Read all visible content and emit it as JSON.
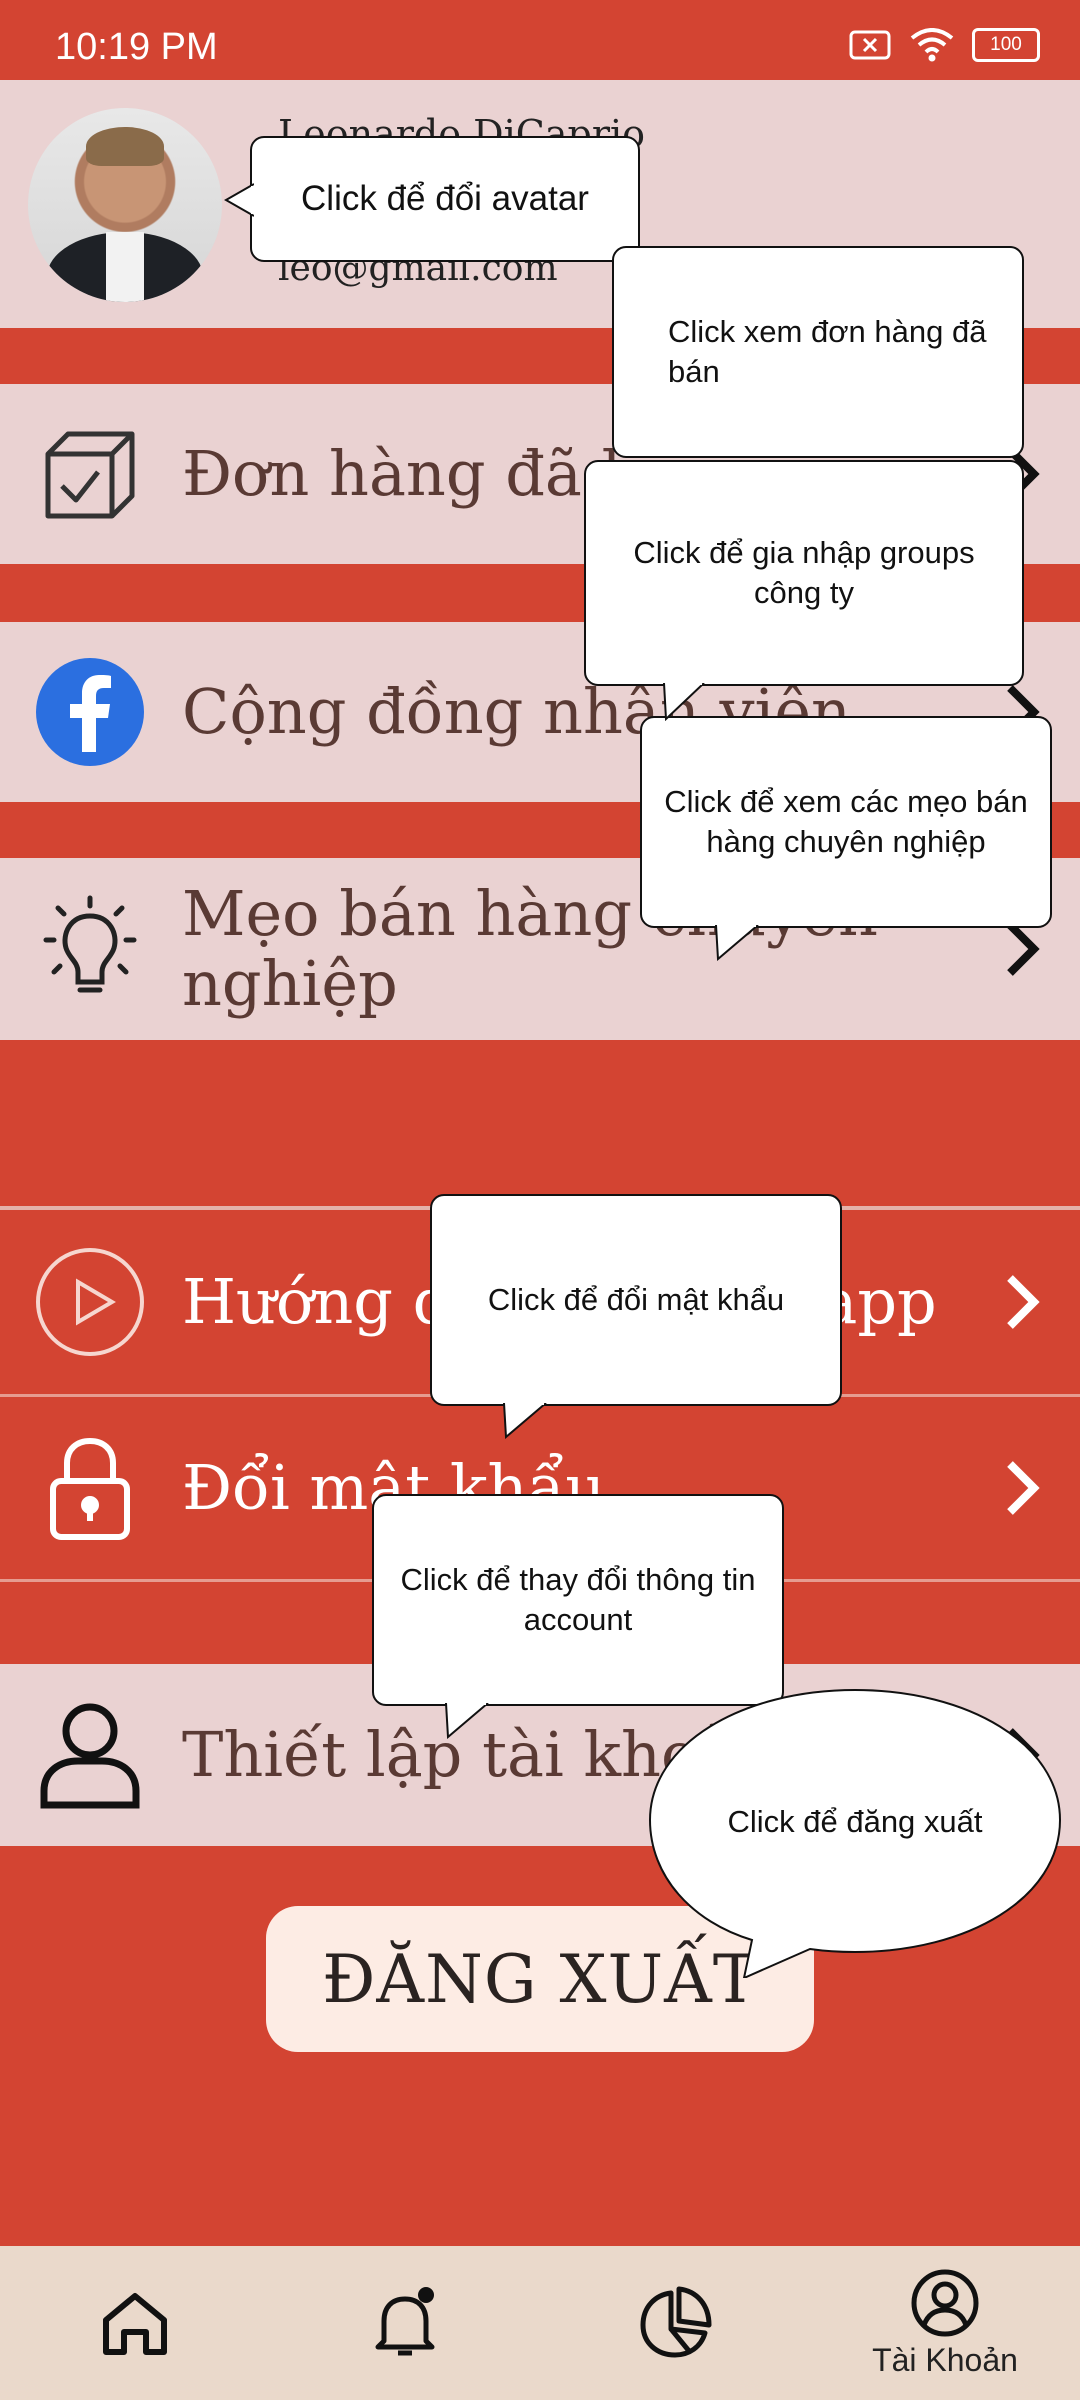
{
  "status_bar": {
    "time": "10:19 PM",
    "battery": "100"
  },
  "profile": {
    "name": "Leonardo DiCaprio",
    "email": "leo@gmail.com"
  },
  "menu": [
    {
      "label": "Đơn hàng đã bán",
      "icon": "box-check-icon"
    },
    {
      "label": "Cộng đồng nhân viên",
      "icon": "facebook-icon"
    },
    {
      "label": "Mẹo bán hàng chuyên nghiệp",
      "icon": "lightbulb-icon"
    },
    {
      "label": "Hướng dẫn sử dụng app",
      "icon": "play-icon"
    },
    {
      "label": "Đổi mật khẩu",
      "icon": "lock-icon"
    },
    {
      "label": "Thiết lập tài khoản",
      "icon": "user-icon"
    }
  ],
  "logout_label": "ĐĂNG XUẤT",
  "bottom_nav": {
    "account_label": "Tài Khoản"
  },
  "tooltips": {
    "avatar": "Click để đổi avatar",
    "orders": "Click xem đơn hàng đã bán",
    "community": "Click để gia nhập groups công ty",
    "tips": "Click để xem các mẹo bán hàng chuyên nghiệp",
    "password": "Click để đổi mật khẩu",
    "account": "Click để thay đổi thông tin account",
    "logout": "Click để đăng xuất"
  }
}
